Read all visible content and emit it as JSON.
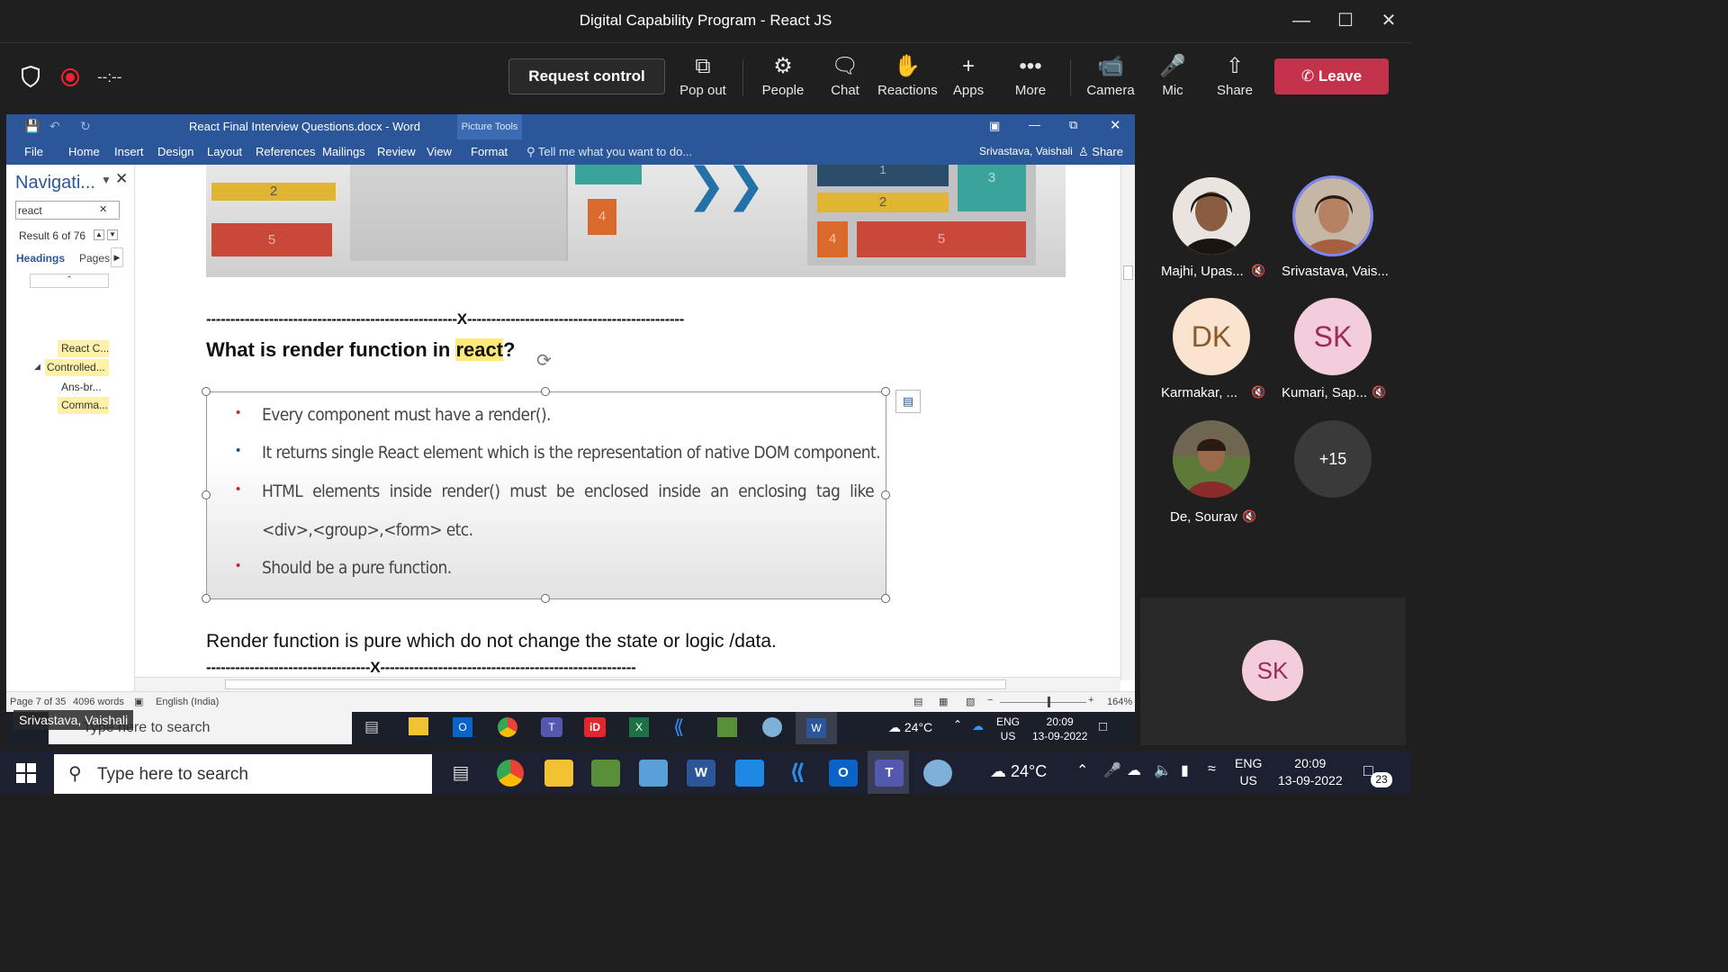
{
  "window": {
    "title": "Digital Capability Program - React JS"
  },
  "meeting": {
    "timer": "--:--",
    "request_control": "Request control",
    "buttons": {
      "popout": "Pop out",
      "people": "People",
      "chat": "Chat",
      "reactions": "Reactions",
      "apps": "Apps",
      "more": "More",
      "camera": "Camera",
      "mic": "Mic",
      "share": "Share"
    },
    "leave": "Leave",
    "presenter_label": "Srivastava, Vaishali"
  },
  "word": {
    "title": "React Final Interview Questions.docx - Word",
    "picture_tools": "Picture Tools",
    "tabs": [
      "File",
      "Home",
      "Insert",
      "Design",
      "Layout",
      "References",
      "Mailings",
      "Review",
      "View",
      "Format"
    ],
    "tell_me": "Tell me what you want to do...",
    "user": "Srivastava, Vaishali",
    "share": "Share",
    "nav": {
      "title": "Navigati...",
      "search_value": "react",
      "result": "Result 6 of 76",
      "tab_headings": "Headings",
      "tab_pages": "Pages",
      "items": [
        "React C...",
        "Controlled...",
        "Ans-br...",
        "Comma..."
      ]
    },
    "doc": {
      "graphic_numbers": [
        "2",
        "5",
        "4",
        "1",
        "3",
        "2",
        "4",
        "5"
      ],
      "separator1": "----------------------------------------------------X---------------------------------------------",
      "heading_pre": "What is render function in ",
      "heading_hl": "react",
      "heading_post": "?",
      "bullets": [
        "Every component must have a render().",
        "It returns single React element which is the representation of native DOM component.",
        "HTML elements inside render() must be enclosed inside an enclosing tag like",
        "Should be a pure function."
      ],
      "bullet3_cont": "<div>,<group>,<form> etc.",
      "para": "Render function is pure which do not change the state or logic /data.",
      "separator2": "----------------------------------X-----------------------------------------------------"
    },
    "status": {
      "page": "Page 7 of 35",
      "words": "4096 words",
      "lang": "English (India)",
      "zoom": "164%"
    }
  },
  "inner_taskbar": {
    "search": "Type here to search",
    "temp": "24°C",
    "lang1": "ENG",
    "lang2": "US",
    "time": "20:09",
    "date": "13-09-2022"
  },
  "participants": [
    {
      "name": "Majhi, Upas...",
      "initials": "",
      "bg": "#d8c8b8"
    },
    {
      "name": "Srivastava, Vais...",
      "initials": "",
      "bg": "#c9a98c"
    },
    {
      "name": "Karmakar, ...",
      "initials": "DK",
      "bg": "#fbe4cf",
      "fg": "#8a5a2b"
    },
    {
      "name": "Kumari, Sap...",
      "initials": "SK",
      "bg": "#f4cddd",
      "fg": "#9c2a5a"
    },
    {
      "name": "De, Sourav",
      "initials": "",
      "bg": "#6e6650"
    },
    {
      "name": "",
      "initials": "+15",
      "bg": "#3a3a3a",
      "fg": "#fff"
    }
  ],
  "self_tile": {
    "initials": "SK"
  },
  "taskbar": {
    "search": "Type here to search",
    "temp": "24°C",
    "lang1": "ENG",
    "lang2": "US",
    "time": "20:09",
    "date": "13-09-2022",
    "notif": "23"
  }
}
